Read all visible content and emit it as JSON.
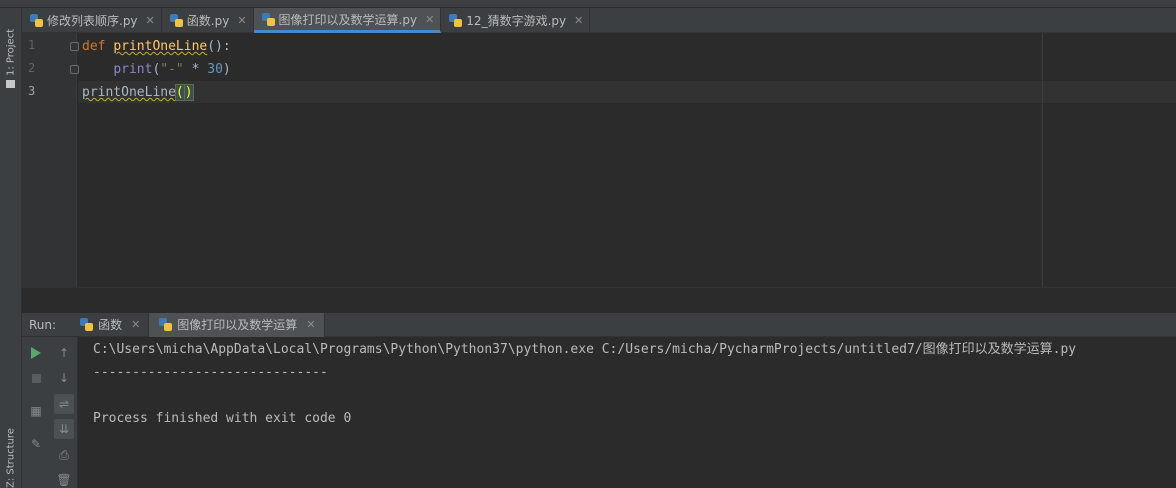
{
  "sidebar": {
    "project_tab": "1: Project",
    "structure_tab": "Z: Structure"
  },
  "editor_tabs": [
    {
      "label": "修改列表顺序.py",
      "active": false
    },
    {
      "label": "函数.py",
      "active": false
    },
    {
      "label": "图像打印以及数学运算.py",
      "active": true
    },
    {
      "label": "12_猜数字游戏.py",
      "active": false
    }
  ],
  "editor": {
    "line_numbers": [
      "1",
      "2",
      "3"
    ],
    "lines": {
      "l1_def": "def",
      "l1_name": "printOneLine",
      "l1_rest": "():",
      "l2_indent": "    ",
      "l2_print": "print",
      "l2_open": "(",
      "l2_str": "\"-\"",
      "l2_op": " * ",
      "l2_num": "30",
      "l2_close": ")",
      "l3_name": "printOneLine",
      "l3_open": "(",
      "l3_close": ")"
    }
  },
  "run_panel": {
    "label": "Run:",
    "tabs": [
      {
        "label": "函数",
        "active": false
      },
      {
        "label": "图像打印以及数学运算",
        "active": true
      }
    ],
    "console": [
      "C:\\Users\\micha\\AppData\\Local\\Programs\\Python\\Python37\\python.exe C:/Users/micha/PycharmProjects/untitled7/图像打印以及数学运算.py",
      "------------------------------",
      "",
      "Process finished with exit code 0"
    ]
  },
  "colors": {
    "background": "#2b2b2b",
    "keyword": "#cc7832",
    "function": "#ffc66d",
    "string": "#6a8759",
    "number": "#6897bb",
    "accent": "#4a88c7",
    "run_green": "#59a869"
  },
  "icons": [
    "python-file-icon",
    "close-icon",
    "run-icon",
    "stop-icon",
    "up-arrow-icon",
    "down-arrow-icon",
    "layout-icon",
    "pin-icon",
    "soft-wrap-icon",
    "scroll-to-end-icon",
    "print-icon",
    "trash-icon",
    "folder-icon"
  ]
}
